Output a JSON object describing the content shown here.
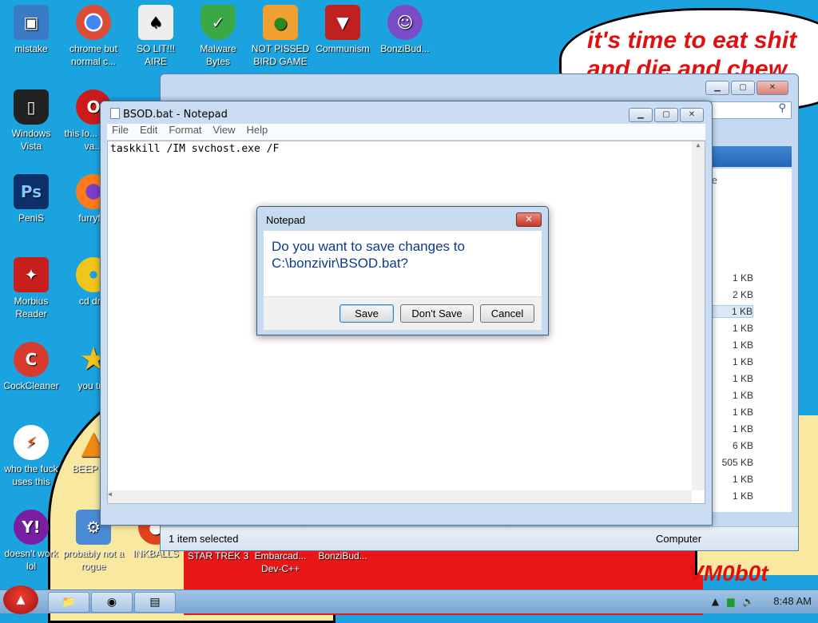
{
  "wallpaper": {
    "text_line1": "it's time to eat shit",
    "text_line2": "and die and chew",
    "signature": "VM0b0t"
  },
  "desktop_icons": [
    {
      "label": "mistake",
      "icon": "computer-icon",
      "color": "#3a7bc8"
    },
    {
      "label": "chrome but normal c...",
      "icon": "chrome-icon",
      "color": "#dd4b39"
    },
    {
      "label": "SO LIT!!! AIRE",
      "icon": "cards-icon",
      "color": "#eeeeee"
    },
    {
      "label": "Malware Bytes",
      "icon": "shield-icon",
      "color": "#39a845"
    },
    {
      "label": "NOT PISSED BIRD GAME",
      "icon": "pig-icon",
      "color": "#f0a030"
    },
    {
      "label": "Communism",
      "icon": "flag-icon",
      "color": "#c02020"
    },
    {
      "label": "BonziBud...",
      "icon": "gorilla-icon",
      "color": "#7a4cc8"
    },
    {
      "label": "Windows Vista",
      "icon": "trash-icon",
      "color": "#222222"
    },
    {
      "label": "this lo... like a va...",
      "icon": "opera-icon",
      "color": "#cc1b1b"
    },
    {
      "label": "PeniS",
      "icon": "photoshop-icon",
      "color": "#0d2f6a"
    },
    {
      "label": "furryf...",
      "icon": "firefox-icon",
      "color": "#ff7a1a"
    },
    {
      "label": "Morbius Reader",
      "icon": "pdf-icon",
      "color": "#c81e1e"
    },
    {
      "label": "cd dr...",
      "icon": "disc-icon",
      "color": "#f2c51b"
    },
    {
      "label": "CockCleaner",
      "icon": "ccleaner-icon",
      "color": "#d83b2e"
    },
    {
      "label": "you tr...",
      "icon": "star-icon",
      "color": "#f5c21b"
    },
    {
      "label": "who the fuck uses this",
      "icon": "winamp-icon",
      "color": "#f06020"
    },
    {
      "label": "BEEP B...",
      "icon": "vlc-icon",
      "color": "#f08a12"
    },
    {
      "label": "doesn't work lol",
      "icon": "yahoo-icon",
      "color": "#7b1fa2"
    },
    {
      "label": "probably not a rogue",
      "icon": "gear-icon",
      "color": "#4b8bd6"
    },
    {
      "label": "INKBALLS",
      "icon": "inkball-icon",
      "color": "#e0441c"
    },
    {
      "label": "STAR TREK 3",
      "icon": "startrek-icon",
      "color": "#333333"
    },
    {
      "label": "Embarcad... Dev-C++",
      "icon": "devcpp-icon",
      "color": "#4444aa"
    },
    {
      "label": "BonziBud...",
      "icon": "gorilla-icon",
      "color": "#7a4cc8"
    }
  ],
  "explorer": {
    "column_header": "ize",
    "sizes": [
      "1 KB",
      "2 KB",
      "1 KB",
      "1 KB",
      "1 KB",
      "1 KB",
      "1 KB",
      "1 KB",
      "1 KB",
      "1 KB",
      "6 KB",
      "505 KB",
      "1 KB",
      "1 KB"
    ],
    "selected_index": 2,
    "status_left": "1 item selected",
    "status_right": "Computer"
  },
  "notepad": {
    "title": "BSOD.bat - Notepad",
    "menu": [
      "File",
      "Edit",
      "Format",
      "View",
      "Help"
    ],
    "content": "taskkill /IM svchost.exe /F"
  },
  "dialog": {
    "title": "Notepad",
    "message_line1": "Do you want to save changes to",
    "message_line2": "C:\\bonzivir\\BSOD.bat?",
    "buttons": [
      "Save",
      "Don't Save",
      "Cancel"
    ]
  },
  "taskbar": {
    "clock": "8:48 AM",
    "buttons": [
      "explorer-icon",
      "chrome-icon",
      "notepad-icon"
    ]
  }
}
